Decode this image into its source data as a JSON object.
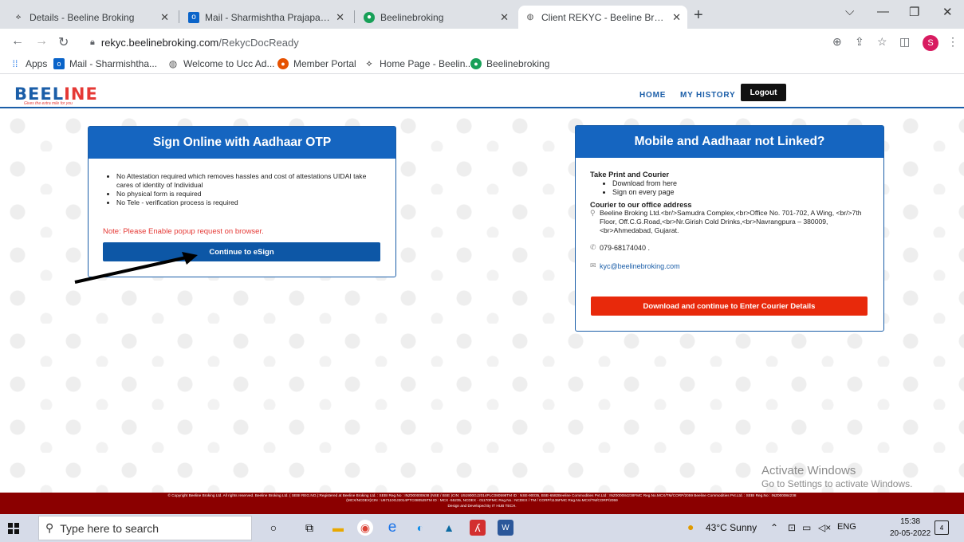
{
  "browser": {
    "tabs": [
      {
        "title": "Details - Beeline Broking",
        "icon": "beeline-favicon"
      },
      {
        "title": "Mail - Sharmishtha Prajapati - Ou",
        "icon": "outlook-favicon"
      },
      {
        "title": "Beelinebroking",
        "icon": "beelinebroking-favicon"
      },
      {
        "title": "Client REKYC - Beeline Broking",
        "icon": "globe-favicon"
      }
    ],
    "url_host": "rekyc.beelinebroking.com",
    "url_path": "/RekycDocReady",
    "profile_initial": "S",
    "bookmarks": [
      {
        "label": "Apps",
        "icon": "apps-grid-icon"
      },
      {
        "label": "Mail - Sharmishtha...",
        "icon": "outlook-icon"
      },
      {
        "label": "Welcome to Ucc Ad...",
        "icon": "globe-icon"
      },
      {
        "label": "Member Portal",
        "icon": "member-portal-icon"
      },
      {
        "label": "Home Page - Beelin...",
        "icon": "beeline-icon"
      },
      {
        "label": "Beelinebroking",
        "icon": "beelinebroking-icon"
      }
    ]
  },
  "site": {
    "logo_text_a": "BEEL",
    "logo_text_b": "INE",
    "logo_tagline": "Gives the extra mile for you",
    "nav": {
      "home": "HOME",
      "history": "MY HISTORY",
      "logout": "Logout"
    }
  },
  "left_card": {
    "title": "Sign Online with Aadhaar OTP",
    "bullets": [
      "No Attestation required which removes hassles and cost of attestations UIDAI take cares of identity of Individual",
      "No physical form is required",
      "No Tele - verification process is required"
    ],
    "note": "Note: Please Enable popup request on browser.",
    "button": "Continue to eSign"
  },
  "right_card": {
    "title": "Mobile and Aadhaar not Linked?",
    "subheading": "Take Print and Courier",
    "bullets": [
      "Download from here",
      "Sign on every page"
    ],
    "address_heading": "Courier to our office address",
    "address": "Beeline Broking Ltd.<br/>Samudra Complex,<br>Office No. 701-702, A Wing, <br/>7th Floor, Off.C.G.Road,<br>Nr.Girish Cold Drinks,<br>Navrangpura – 380009,<br>Ahmedabad, Gujarat.",
    "phone": "079-68174040 .",
    "email": "kyc@beelinebroking.com",
    "button": "Download and continue to Enter Courier Details"
  },
  "watermark": {
    "line1": "Activate Windows",
    "line2": "Go to Settings to activate Windows."
  },
  "footer": {
    "line1": "© Copyright Beeline Broking Ltd. All rights reserved. Beeline Broking Ltd. ( SEBI REG.NO.):Registered at Beeline Broking Ltd. : SEBI Reg.No : INZ000000638 (NSE / BSE )CIN: U51900GJ2014PLC080598TM ID : NSE-90035, BSE-6582Beeline Commodities Pvt.Ltd : INZ000084238FMC Reg.No.MCX/TM/CORP/2059 Beeline Commodities Pvt.Ltd. : SEBI Reg.No : INZ000084238",
    "line2": "(MCX/NCDEX)CIN : U67110GJ2014PTC080525TM ID : MCX -55235, NCDEX - 01170FMC Reg.No.: NCDEX / TM / CORP/1136FMC Reg.No.MCX/TM/CORP/2059",
    "line3": "Design and Developed By IT HUB TECH."
  },
  "taskbar": {
    "search_placeholder": "Type here to search",
    "weather": "43°C  Sunny",
    "lang": "ENG",
    "time": "15:38",
    "date": "20-05-2022",
    "notification_count": "4"
  }
}
